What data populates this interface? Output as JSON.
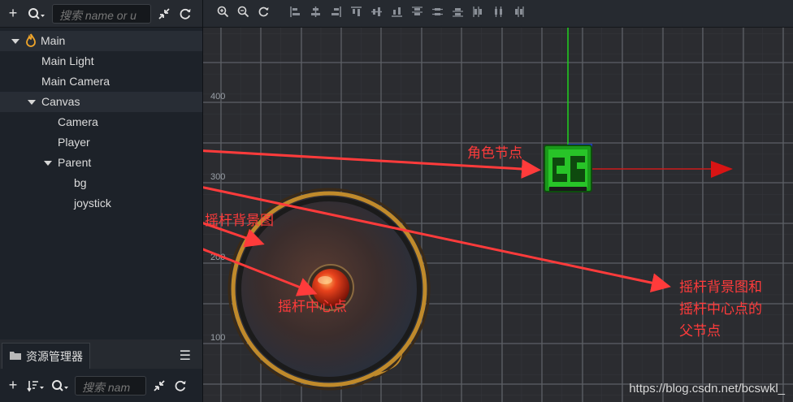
{
  "hierarchy": {
    "toolbar": {
      "add_icon": "plus-icon",
      "search_icon": "search-icon",
      "search_placeholder": "搜索 name or u",
      "collapse_icon": "collapse-icon",
      "refresh_icon": "refresh-icon"
    },
    "nodes": [
      {
        "label": "Main",
        "depth": 0,
        "expanded": true,
        "icon": "scene-flame-icon"
      },
      {
        "label": "Main Light",
        "depth": 1
      },
      {
        "label": "Main Camera",
        "depth": 1
      },
      {
        "label": "Canvas",
        "depth": 1,
        "expanded": true
      },
      {
        "label": "Camera",
        "depth": 2
      },
      {
        "label": "Player",
        "depth": 2
      },
      {
        "label": "Parent",
        "depth": 2,
        "expanded": true
      },
      {
        "label": "bg",
        "depth": 3
      },
      {
        "label": "joystick",
        "depth": 3
      }
    ]
  },
  "assets": {
    "tab_label": "资源管理器",
    "tab_icon": "folder-icon",
    "menu_icon": "menu-icon",
    "search_placeholder": "搜索 nam"
  },
  "scene_toolbar": {
    "icons": [
      "zoom-in-icon",
      "zoom-out-icon",
      "reset-view-icon",
      "align-left-icon",
      "align-hcenter-icon",
      "align-right-icon",
      "align-top-icon",
      "align-vcenter-icon",
      "align-bottom-icon",
      "distribute-top-icon",
      "distribute-vcenter-icon",
      "distribute-bottom-icon",
      "distribute-left-icon",
      "distribute-hcenter-icon",
      "distribute-right-icon"
    ]
  },
  "scene": {
    "grid_labels": [
      "400",
      "300",
      "200",
      "100"
    ],
    "annotations": {
      "player": "角色节点",
      "bg": "摇杆背景图",
      "joystick": "摇杆中心点",
      "parent_line1": "摇杆背景图和",
      "parent_line2": "摇杆中心点的",
      "parent_line3": "父节点"
    },
    "watermark": "https://blog.csdn.net/bcswkl_",
    "colors": {
      "annotation": "#ff3b3b",
      "grid": "#5d6066",
      "background": "#2b2c30"
    }
  }
}
